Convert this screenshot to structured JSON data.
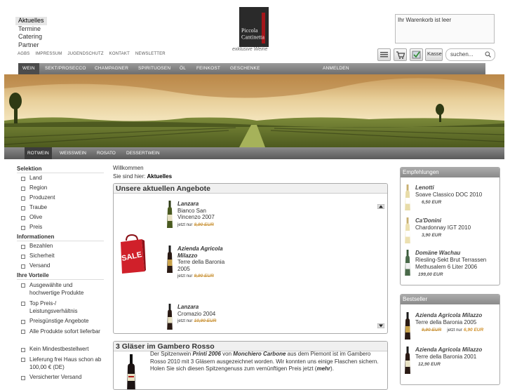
{
  "top_nav": {
    "items": [
      "Aktuelles",
      "Termine",
      "Catering",
      "Partner"
    ],
    "small_links": [
      "AGBS",
      "IMPRESSUM",
      "JUGENDSCHUTZ",
      "KONTAKT",
      "NEWSLETTER"
    ]
  },
  "logo": {
    "line1": "Piccola",
    "line2": "Cantinetta",
    "slogan": "exklusive Weine"
  },
  "cart": {
    "status": "Ihr Warenkorb ist leer",
    "checkout_label": "Kasse",
    "search_placeholder": "suchen..."
  },
  "main_nav": {
    "items": [
      "WEIN",
      "SEKT/PROSECCO",
      "CHAMPAGNER",
      "SPIRITUOSEN",
      "ÖL",
      "FEINKOST",
      "GESCHENKE"
    ],
    "login": "ANMELDEN"
  },
  "sub_nav": {
    "items": [
      "ROTWEIN",
      "WEISSWEIN",
      "ROSATO",
      "DESSERTWEIN"
    ]
  },
  "sidebar": {
    "selection_title": "Selektion",
    "selection_items": [
      "Land",
      "Region",
      "Produzent",
      "Traube",
      "Olive",
      "Preis"
    ],
    "info_title": "Informationen",
    "info_items": [
      "Bezahlen",
      "Sicherheit",
      "Versand"
    ],
    "benefits_title": "Ihre Vorteile",
    "benefits_items": [
      "Ausgewählte und hochwertige Produkte",
      "Top Preis-/ Leistungsverhältnis",
      "Preisgünstige Angebote",
      "Alle Produkte sofort lieferbar",
      "Kein Mindestbestellwert",
      "Lieferung frei Haus schon ab 100,00 € (DE)",
      "Versicherter Versand"
    ]
  },
  "breadcrumb": {
    "welcome": "Willkommen",
    "prefix": "Sie sind hier:",
    "current": "Aktuelles"
  },
  "offers": {
    "title": "Unsere aktuellen Angebote",
    "sale_text": "SALE",
    "items": [
      {
        "producer": "Lanzara",
        "name": "Bianco San Vincenzo 2007",
        "old_price": "8,90 EUR",
        "now": "jetzt nur"
      },
      {
        "producer": "Azienda Agricola Milazzo",
        "name": "Terre della Baronia 2005",
        "old_price": "9,90 EUR",
        "now": "jetzt nur"
      },
      {
        "producer": "Lanzara",
        "name": "Cromazio 2004",
        "old_price": "10,90 EUR",
        "now": "jetzt nur"
      }
    ]
  },
  "gambero": {
    "title": "3 Gläser im Gambero Rosso",
    "text_a": "Der Spitzenwein ",
    "wine": "Printi 2006",
    "text_b": " von ",
    "producer": "Monchiero Carbone",
    "text_c": " aus dem Piemont ist im Gambero Rosso 2010 mit 3 Gläsern ausgezeichnet worden. Wir konnten uns einige Flaschen sichern. Holen Sie sich diesen Spitzengenuss zum vernünftigen Preis jetzt (",
    "more": "mehr",
    "text_d": ")."
  },
  "recommendations": {
    "title": "Empfehlungen",
    "items": [
      {
        "producer": "Lenotti",
        "name": "Soave Classico DOC 2010",
        "price": "6,50 EUR"
      },
      {
        "producer": "Ca'Donini",
        "name": "Chardonnay IGT 2010",
        "price": "3,90 EUR"
      },
      {
        "producer": "Domäne Wachau",
        "name": "Riesling-Sekt Brut Terrassen Methusalem 6 Liter 2006",
        "price": "199,00 EUR"
      }
    ]
  },
  "bestseller": {
    "title": "Bestseller",
    "items": [
      {
        "producer": "Azienda Agricola Milazzo",
        "name": "Terre della Baronia 2005",
        "old_price": "9,90 EUR",
        "now": "jetzt nur",
        "price": "6,90 EUR"
      },
      {
        "producer": "Azienda Agricola Milazzo",
        "name": "Terre della Baronia 2001",
        "price": "12,90 EUR"
      }
    ]
  },
  "colors": {
    "accent_price": "#d0902a",
    "nav_dark": "#4c4c4c",
    "sale_red": "#d0202a"
  }
}
